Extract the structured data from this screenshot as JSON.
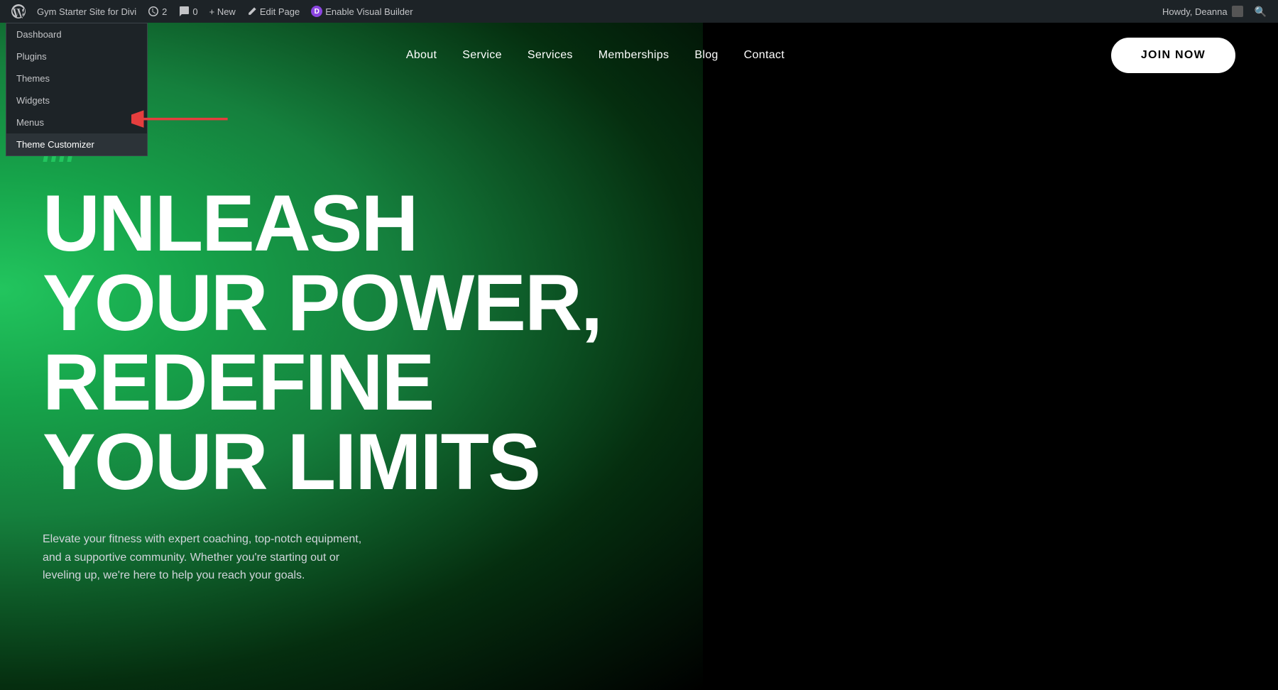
{
  "adminBar": {
    "siteName": "Gym Starter Site for Divi",
    "revisionsCount": "2",
    "commentsCount": "0",
    "newLabel": "+ New",
    "editPageLabel": "Edit Page",
    "diviLabel": "Enable Visual Builder",
    "howdy": "Howdy, Deanna",
    "searchIcon": "🔍"
  },
  "dropdown": {
    "items": [
      {
        "label": "Dashboard"
      },
      {
        "label": "Plugins"
      },
      {
        "label": "Themes"
      },
      {
        "label": "Widgets"
      },
      {
        "label": "Menus"
      },
      {
        "label": "Theme Customizer"
      }
    ]
  },
  "nav": {
    "items": [
      {
        "label": "About"
      },
      {
        "label": "Service"
      },
      {
        "label": "Services"
      },
      {
        "label": "Memberships"
      },
      {
        "label": "Blog"
      },
      {
        "label": "Contact"
      }
    ],
    "joinNow": "JOIN NOW"
  },
  "hero": {
    "slashes": "////",
    "headline": "UNLEASH YOUR POWER, REDEFINE YOUR LIMITS",
    "subtext": "Elevate your fitness with expert coaching, top-notch equipment, and a supportive community. Whether you're starting out or leveling up, we're here to help you reach your goals."
  }
}
